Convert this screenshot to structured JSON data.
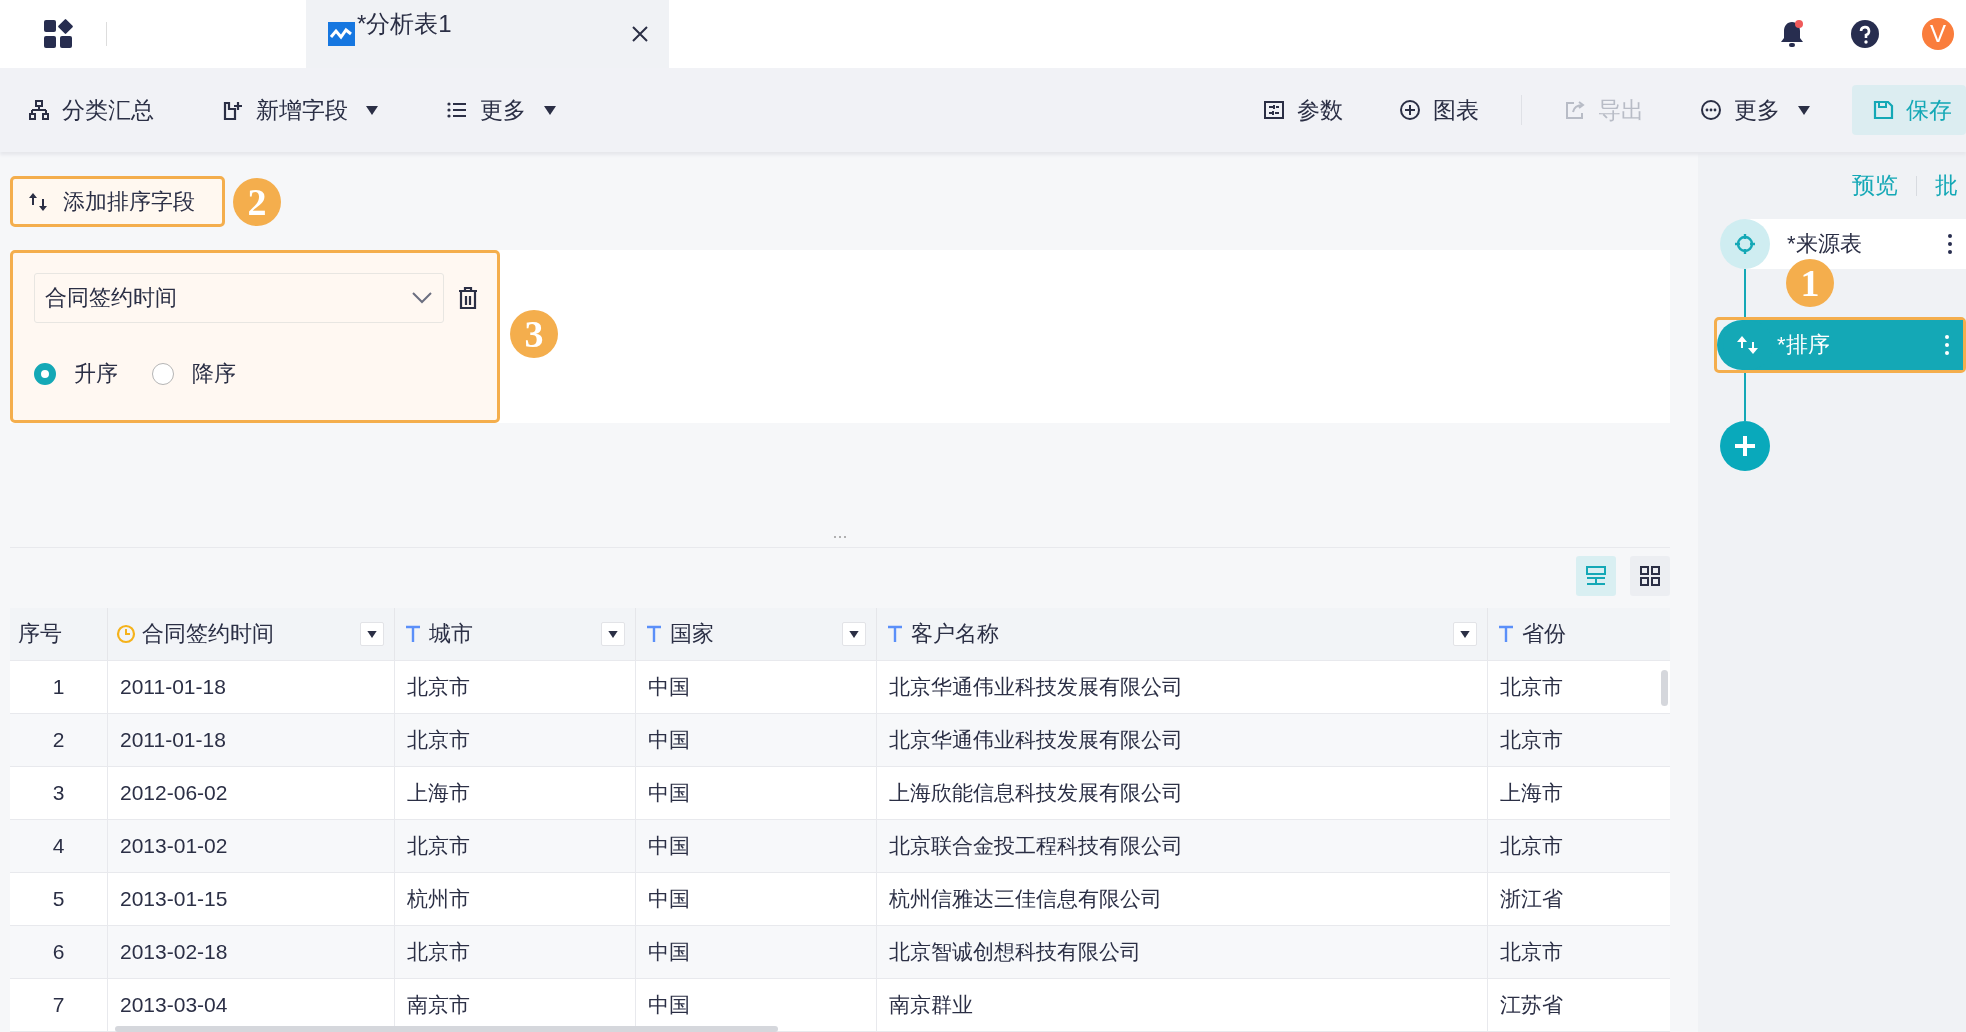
{
  "app_bar": {
    "tabs": [
      {
        "title": "*分析表1",
        "selected": true
      }
    ],
    "avatar": "V",
    "has_notification": true
  },
  "toolbar": {
    "left": [
      {
        "label": "分类汇总",
        "has_menu": false,
        "disabled": false
      },
      {
        "label": "新增字段",
        "has_menu": true,
        "disabled": false
      },
      {
        "label": "更多",
        "has_menu": true,
        "disabled": false
      }
    ],
    "right": [
      {
        "label": "参数",
        "has_menu": false,
        "disabled": false,
        "kind": "plain"
      },
      {
        "label": "图表",
        "has_menu": false,
        "disabled": false,
        "kind": "plain"
      },
      {
        "label": "导出",
        "has_menu": false,
        "disabled": true,
        "kind": "plain"
      },
      {
        "label": "更多",
        "has_menu": true,
        "disabled": false,
        "kind": "plain"
      },
      {
        "label": "保存",
        "has_menu": false,
        "disabled": false,
        "kind": "primary"
      }
    ]
  },
  "sort_panel": {
    "add_button": "添加排序字段",
    "add_marker": "2",
    "rules_marker": "3",
    "rules": [
      {
        "field": "合同签约时间",
        "orders": [
          {
            "label": "升序",
            "selected": true
          },
          {
            "label": "降序",
            "selected": false
          }
        ]
      }
    ]
  },
  "view_modes": [
    {
      "selected": true
    },
    {
      "selected": false
    }
  ],
  "table": {
    "columns": [
      {
        "label": "序号",
        "kind": "index",
        "filter": false
      },
      {
        "label": "合同签约时间",
        "kind": "date",
        "filter": true
      },
      {
        "label": "城市",
        "kind": "text",
        "filter": true
      },
      {
        "label": "国家",
        "kind": "text",
        "filter": true
      },
      {
        "label": "客户名称",
        "kind": "text",
        "filter": true
      },
      {
        "label": "省份",
        "kind": "text",
        "filter": false
      }
    ],
    "rows": [
      [
        "1",
        "2011-01-18",
        "北京市",
        "中国",
        "北京华通伟业科技发展有限公司",
        "北京市"
      ],
      [
        "2",
        "2011-01-18",
        "北京市",
        "中国",
        "北京华通伟业科技发展有限公司",
        "北京市"
      ],
      [
        "3",
        "2012-06-02",
        "上海市",
        "中国",
        "上海欣能信息科技发展有限公司",
        "上海市"
      ],
      [
        "4",
        "2013-01-02",
        "北京市",
        "中国",
        "北京联合金投工程科技有限公司",
        "北京市"
      ],
      [
        "5",
        "2013-01-15",
        "杭州市",
        "中国",
        "杭州信雅达三佳信息有限公司",
        "浙江省"
      ],
      [
        "6",
        "2013-02-18",
        "北京市",
        "中国",
        "北京智诚创想科技有限公司",
        "北京市"
      ],
      [
        "7",
        "2013-03-04",
        "南京市",
        "中国",
        "南京群业",
        "江苏省"
      ]
    ]
  },
  "flow_panel": {
    "links": [
      "预览",
      "批"
    ],
    "step_marker": "1",
    "steps": [
      {
        "label": "*来源表",
        "kind": "source",
        "selected": false
      },
      {
        "label": "*排序",
        "kind": "sort",
        "selected": true
      }
    ]
  }
}
